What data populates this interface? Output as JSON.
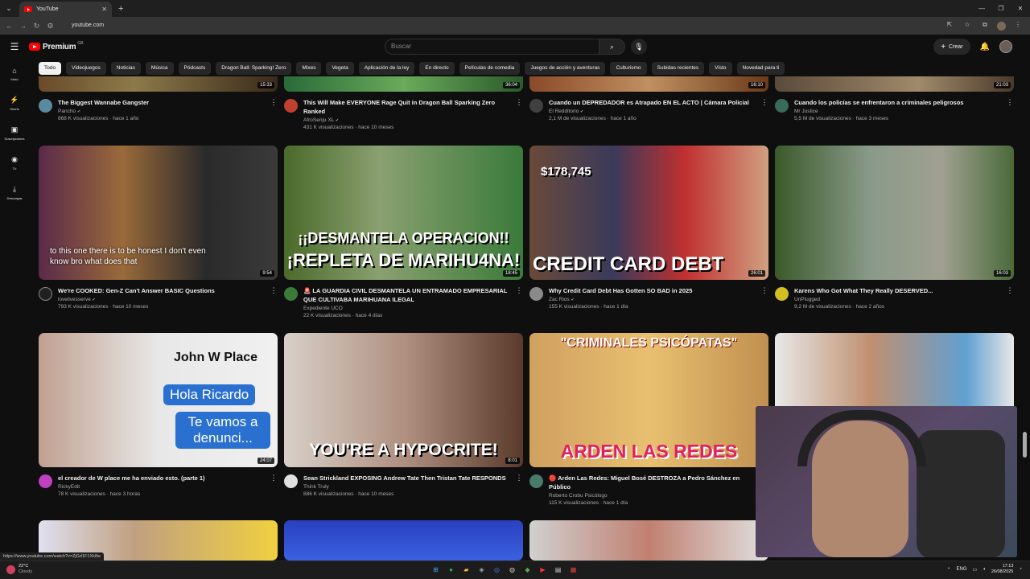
{
  "browser": {
    "tab_title": "YouTube",
    "url": "youtube.com",
    "status_url": "https://www.youtube.com/watch?v=ZjGd1F1Xk8w"
  },
  "masthead": {
    "brand": "Premium",
    "country": "GB",
    "search_placeholder": "Buscar",
    "create_label": "Crear"
  },
  "guide": [
    {
      "label": "Inicio",
      "icon": "home-icon"
    },
    {
      "label": "Shorts",
      "icon": "shorts-icon"
    },
    {
      "label": "Suscripciones",
      "icon": "subscriptions-icon"
    },
    {
      "label": "Tú",
      "icon": "you-icon"
    },
    {
      "label": "Descargas",
      "icon": "download-icon"
    }
  ],
  "chips": [
    "Todo",
    "Videojuegos",
    "Noticias",
    "Música",
    "Pódcasts",
    "Dragon Ball: Sparking! Zero",
    "Mixes",
    "Vegeta",
    "Aplicación de la ley",
    "En directo",
    "Películas de comedia",
    "Juegos de acción y aventuras",
    "Culturismo",
    "Subidas recientes",
    "Visto",
    "Novedad para ti"
  ],
  "row1": [
    {
      "duration": "15:33",
      "title": "The Biggest Wannabe Gangster",
      "channel": "Pancho",
      "stats": "868 K visualizaciones · hace 1 año",
      "avatar_color": "#5a8aa0"
    },
    {
      "duration": "36:04",
      "title": "This Will Make EVERYONE Rage Quit in Dragon Ball Sparking Zero Ranked",
      "channel": "AfroSenju XL",
      "stats": "431 K visualizaciones · hace 10 meses",
      "avatar_color": "#c04030"
    },
    {
      "duration": "16:10",
      "title": "Cuando un DEPREDADOR es Atrapado EN EL ACTO | Cámara Policial",
      "channel": "El Redditorio",
      "stats": "2,1 M de visualizaciones · hace 1 año",
      "avatar_color": "#404040"
    },
    {
      "duration": "21:03",
      "title": "Cuando los policías se enfrentaron a criminales peligrosos",
      "channel": "Mr Justice",
      "stats": "5,5 M de visualizaciones · hace 3 meses",
      "avatar_color": "#3a6a5a"
    }
  ],
  "row2": [
    {
      "duration": "9:54",
      "caption": "to this one there is to be honest I don't even know bro what does that",
      "title": "We're COOKED: Gen-Z Can't Answer BASIC Questions",
      "channel": "lovelivesserve",
      "stats": "793 K visualizaciones · hace 10 meses",
      "avatar_color": "#202020"
    },
    {
      "duration": "18:45",
      "big1": "¡¡DESMANTELA OPERACION!!",
      "big2": "¡REPLETA DE MARIHU4NA!",
      "title": "🚨 LA GUARDIA CIVIL DESMANTELA UN ENTRAMADO EMPRESARIAL QUE CULTIVABA MARIHUANA ILEGAL",
      "channel": "Expediente UCO",
      "stats": "22 K visualizaciones · hace 4 días",
      "avatar_color": "#3a7a3a"
    },
    {
      "duration": "26:01",
      "big1": "$178,745",
      "big2": "CREDIT CARD DEBT",
      "title": "Why Credit Card Debt Has Gotten SO BAD in 2025",
      "channel": "Zac Rios",
      "stats": "155 K visualizaciones · hace 1 día",
      "avatar_color": "#8a8a8a"
    },
    {
      "duration": "16:03",
      "title": "Karens Who Got What They Really DESERVED...",
      "channel": "UnPlugged",
      "stats": "9,2 M de visualizaciones · hace 2 años",
      "avatar_color": "#d0c020"
    }
  ],
  "row3": [
    {
      "duration": "24:07",
      "t1": "John W Place",
      "t2": "Hola Ricardo",
      "t3": "Te vamos a denunci...",
      "title": "el creador de W place me ha enviado esto. (parte 1)",
      "channel": "RickyEdit",
      "stats": "78 K visualizaciones · hace 3 horas",
      "avatar_color": "#c040c0"
    },
    {
      "duration": "8:01",
      "big1": "YOU'RE A HYPOCRITE!",
      "title": "Sean Strickland EXPOSING Andrew Tate Then Tristan Tate RESPONDS",
      "channel": "Think Truly",
      "stats": "886 K visualizaciones · hace 10 meses",
      "avatar_color": "#e0e0e0"
    },
    {
      "duration": "",
      "big1": "\"CRIMINALES PSICÓPATAS\"",
      "big2": "ARDEN LAS REDES",
      "title": "🔴 Arden Las Redes: Miguel Bosé DESTROZA a Pedro Sánchez en Público",
      "channel": "Roberto Crobu Psicólogo",
      "stats": "115 K visualizaciones · hace 1 día",
      "avatar_color": "#4a7a6a"
    }
  ],
  "taskbar": {
    "temp": "22°C",
    "weather": "Cloudy",
    "lang": "ENG",
    "time": "17:13",
    "date": "26/08/2025"
  }
}
